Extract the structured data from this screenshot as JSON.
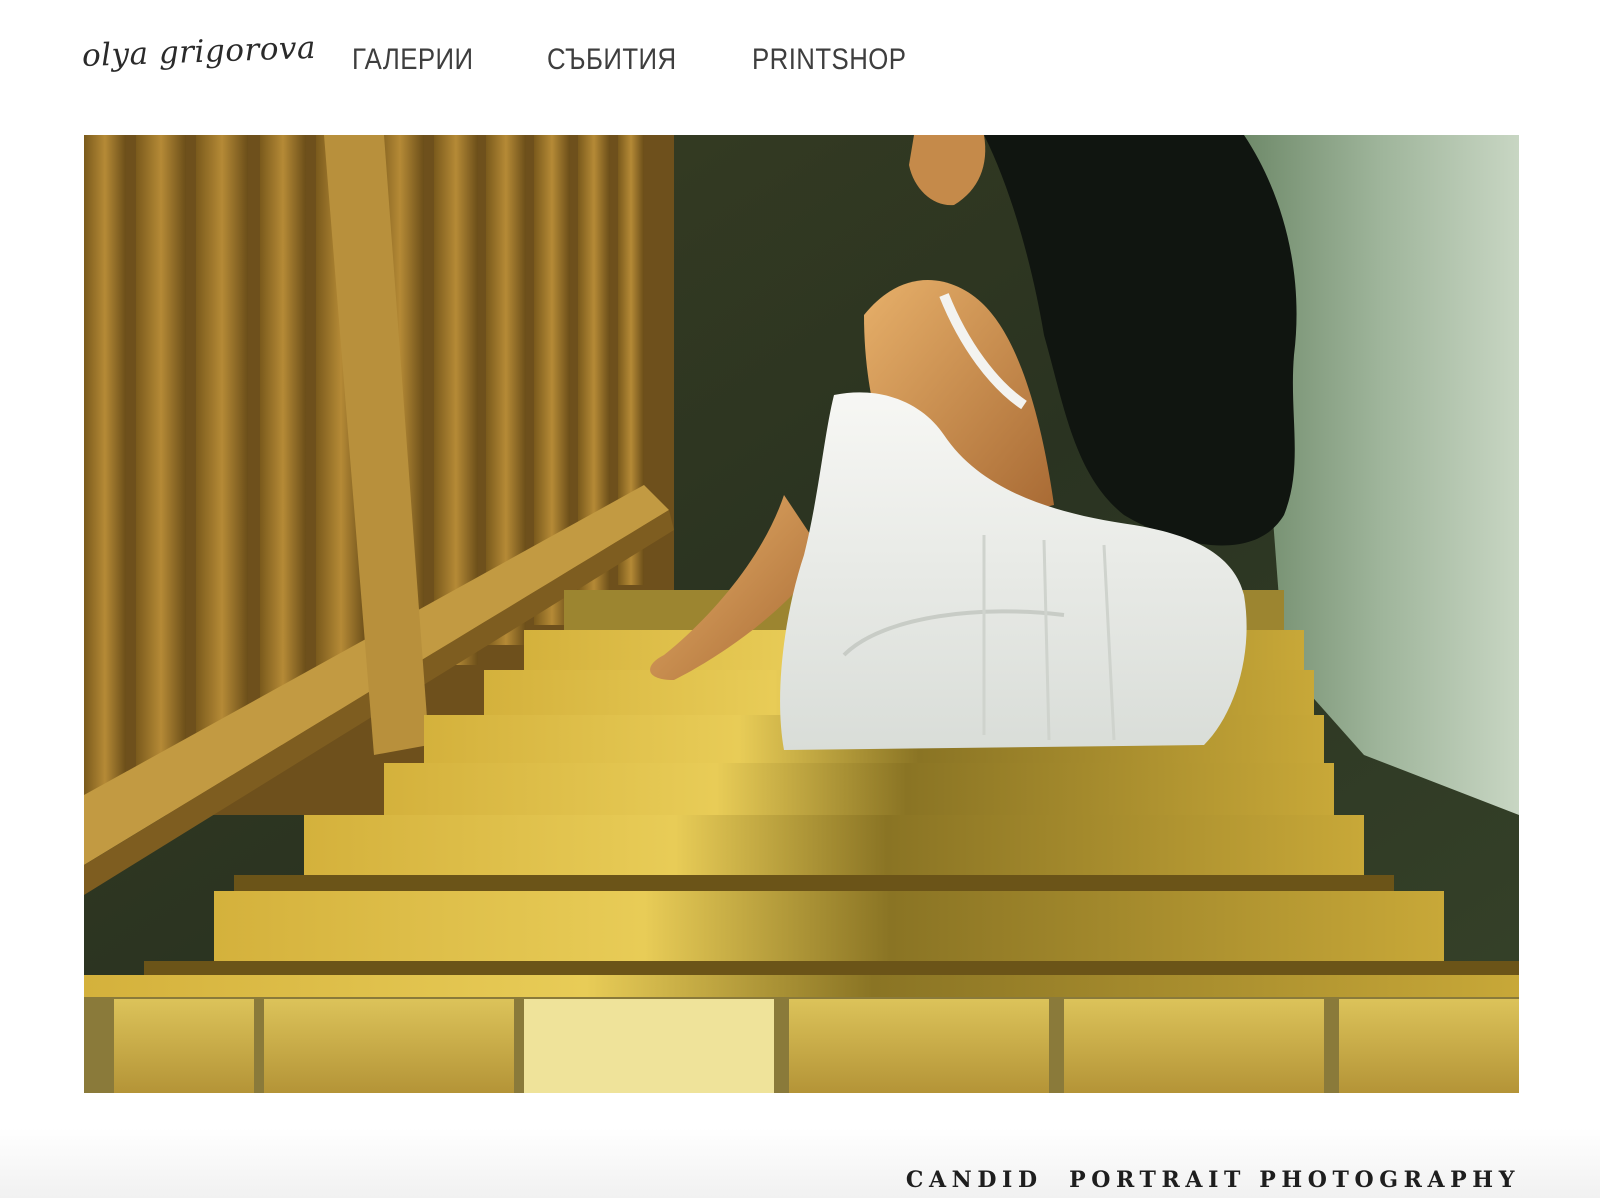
{
  "site": {
    "logo_text": "olya grigorova"
  },
  "nav": {
    "items": [
      {
        "label": "ГАЛЕРИИ"
      },
      {
        "label": "СЪБИТИЯ"
      },
      {
        "label": "PRINTSHOP"
      }
    ]
  },
  "hero": {
    "alt": "Woman in a white dress sitting on sunlit wooden stairs"
  },
  "footer": {
    "tagline": "CANDID  PORTRAIT PHOTOGRAPHY"
  },
  "colors": {
    "nav_text": "#3e3e3e",
    "logo_text": "#2a2a2a",
    "tagline_text": "#1e1e1e",
    "background": "#ffffff"
  }
}
